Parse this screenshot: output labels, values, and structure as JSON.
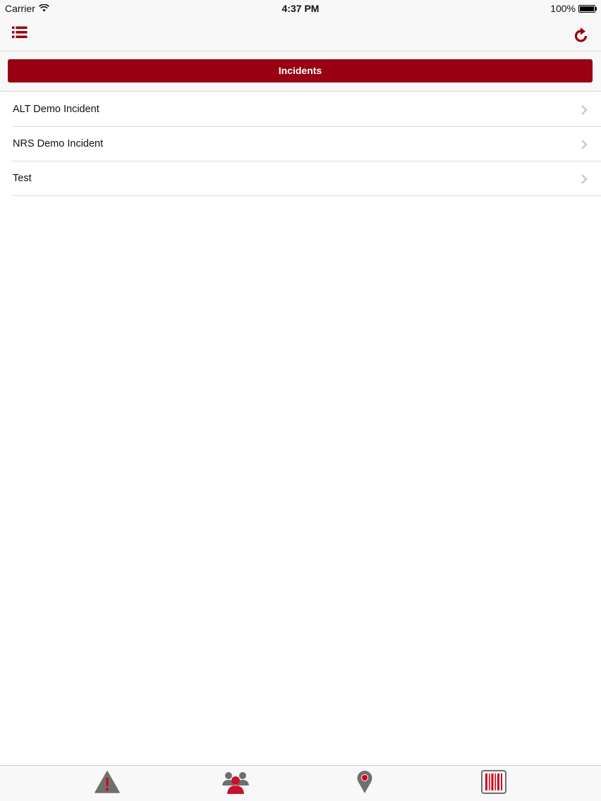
{
  "status_bar": {
    "carrier": "Carrier",
    "time": "4:37 PM",
    "battery": "100%",
    "battery_level": 1.0
  },
  "nav_bar": {
    "left_icon": "list-menu-icon",
    "right_icon": "refresh-icon"
  },
  "header": {
    "title": "Incidents"
  },
  "incidents": [
    {
      "label": "ALT Demo Incident"
    },
    {
      "label": "NRS Demo Incident"
    },
    {
      "label": "Test"
    }
  ],
  "tab_bar": {
    "tabs": [
      {
        "icon": "warning-icon"
      },
      {
        "icon": "people-icon"
      },
      {
        "icon": "map-pin-icon"
      },
      {
        "icon": "barcode-icon"
      }
    ]
  },
  "colors": {
    "accent": "#990012",
    "icon_gray": "#6f6f6f",
    "bar_bg": "#f8f8f8"
  }
}
